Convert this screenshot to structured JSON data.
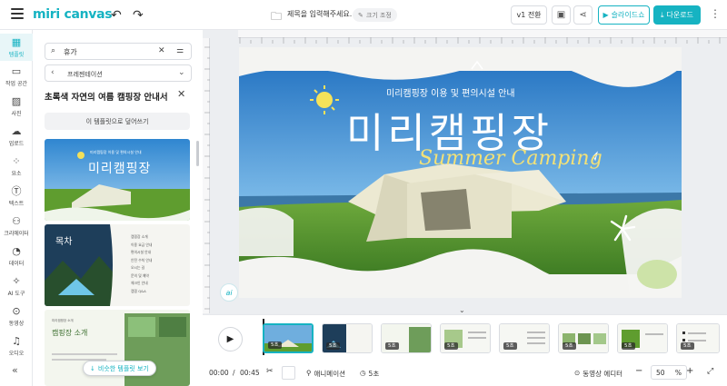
{
  "app": {
    "logo": "miri canvas"
  },
  "toolbar": {
    "title_placeholder": "제목을 입력해주세요.",
    "size_label": "크기 조정",
    "version_label": "v1 전환",
    "slideshow_label": "슬라이드쇼",
    "download_label": "다운로드"
  },
  "nav": {
    "items": [
      {
        "label": "템플릿",
        "icon": "template-icon"
      },
      {
        "label": "작업 공간",
        "icon": "workspace-icon"
      },
      {
        "label": "사진",
        "icon": "photo-icon"
      },
      {
        "label": "업로드",
        "icon": "upload-icon"
      },
      {
        "label": "요소",
        "icon": "elements-icon"
      },
      {
        "label": "텍스트",
        "icon": "text-icon"
      },
      {
        "label": "크리에이터",
        "icon": "creator-icon"
      },
      {
        "label": "데이터",
        "icon": "data-icon"
      },
      {
        "label": "AI 도구",
        "icon": "ai-tools-icon"
      },
      {
        "label": "동영상",
        "icon": "video-icon"
      },
      {
        "label": "오디오",
        "icon": "audio-icon"
      }
    ]
  },
  "panel": {
    "search_value": "휴가",
    "filter_label": "프레젠테이션",
    "template_name": "초록색 자연의 여름 캠핑장 안내서",
    "use_label": "이 템플릿으로 덮어쓰기",
    "similar_label": "비슷한 템플릿 보기",
    "thumbs": [
      {
        "title": "미리캠핑장",
        "sub": "미리캠핑장 이용 및 편의시설 안내"
      },
      {
        "title": "목차",
        "items": [
          "캠핑장 소개",
          "이용 요금 안내",
          "편의시설 안내",
          "안전 수칙 안내",
          "오시는 길",
          "문의 및 예약",
          "체크인 안내",
          "캠핑 Q&A"
        ]
      },
      {
        "title": "캠핑장 소개",
        "sub": "미리캠핑장 소개"
      }
    ]
  },
  "slide": {
    "subtitle": "미리캠핑장 이용 및 편의시설 안내",
    "title": "미리캠핑장",
    "script": "Summer Camping",
    "ai_badge": "ai"
  },
  "timeline": {
    "time_current": "00:00",
    "time_sep": "/",
    "time_total": "00:45",
    "animation_label": "애니메이션",
    "duration_label": "5초",
    "editor_label": "동영상 에디터",
    "zoom_value": "50",
    "zoom_unit": "%",
    "frames": [
      {
        "badge": "5초"
      },
      {
        "badge": "5초"
      },
      {
        "badge": "5초"
      },
      {
        "badge": "5초"
      },
      {
        "badge": "5초"
      },
      {
        "badge": "5초"
      },
      {
        "badge": "5초"
      },
      {
        "badge": "5초"
      }
    ]
  },
  "colors": {
    "accent": "#16b3c2",
    "sky": "#5da6dd",
    "grass": "#5f9d2f"
  }
}
